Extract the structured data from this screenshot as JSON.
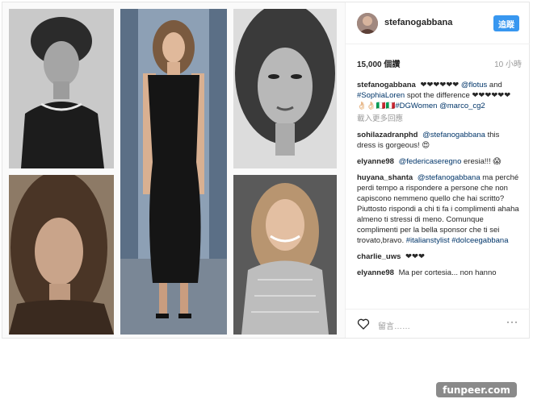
{
  "header": {
    "username": "stefanogabbana",
    "follow_label": "追蹤"
  },
  "stats": {
    "views": "15,000 個讚",
    "time": "10 小時"
  },
  "caption": {
    "user": "stefanogabbana",
    "part1": "❤❤❤❤❤❤",
    "mention1": "@flotus",
    "part2": "and",
    "hashtag1": "#SophiaLoren",
    "part3": "spot the difference ❤❤❤❤❤❤👌🏻👌🏻🇮🇹🇮🇹",
    "hashtag2": "#DGWomen",
    "mention2": "@marco_cg2"
  },
  "load_more": "載入更多回應",
  "comments": [
    {
      "user": "sohilazadranphd",
      "mention": "@stefanogabbana",
      "text": "this dress is gorgeous! 😍"
    },
    {
      "user": "elyanne98",
      "mention": "@federicaseregno",
      "text": "eresia!!! 😱"
    },
    {
      "user": "huyana_shanta",
      "mention": "@stefanogabbana",
      "text": "ma perché perdi tempo a rispondere a persone che non capiscono nemmeno quello che hai scritto? Piuttosto rispondi a chi ti fa i complimenti ahaha almeno ti stressi di meno. Comunque complimenti per la bella sponsor che ti sei trovato,bravo.",
      "hashtag1": "#italianstylist",
      "hashtag2": "#dolceegabbana"
    },
    {
      "user": "charlie_uws",
      "text": "❤❤❤"
    },
    {
      "user": "elyanne98",
      "text": "Ma per cortesia... non hanno"
    }
  ],
  "actions": {
    "comment_placeholder": "留言……",
    "more": "···"
  },
  "watermark": "funpeer.com",
  "colors": {
    "follow_button": "#3897f0",
    "link": "#003569",
    "muted": "#999999"
  }
}
